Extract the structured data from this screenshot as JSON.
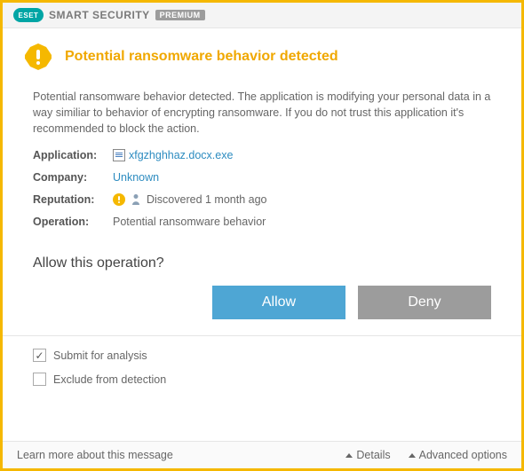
{
  "header": {
    "brand": "ESET",
    "product_name": "SMART SECURITY",
    "edition_badge": "PREMIUM"
  },
  "alert": {
    "title": "Potential ransomware behavior detected",
    "description": "Potential ransomware behavior detected. The application is modifying your personal data in a way similiar to behavior of encrypting ransomware. If you do not trust this application it's recommended to block the action.",
    "fields": {
      "application_label": "Application:",
      "application_value": "xfgzhghhaz.docx.exe",
      "company_label": "Company:",
      "company_value": "Unknown",
      "reputation_label": "Reputation:",
      "reputation_value": "Discovered 1 month ago",
      "operation_label": "Operation:",
      "operation_value": "Potential ransomware behavior"
    }
  },
  "prompt": {
    "question": "Allow this operation?",
    "allow_label": "Allow",
    "deny_label": "Deny"
  },
  "options": {
    "submit_label": "Submit for analysis",
    "submit_checked": true,
    "exclude_label": "Exclude from detection",
    "exclude_checked": false
  },
  "footer": {
    "learn_more": "Learn more about this message",
    "details": "Details",
    "advanced": "Advanced options"
  },
  "colors": {
    "accent_warn": "#f0a800",
    "link": "#2d8cc0",
    "allow_btn": "#4ea6d4",
    "deny_btn": "#9c9c9c",
    "border": "#f5b800"
  }
}
